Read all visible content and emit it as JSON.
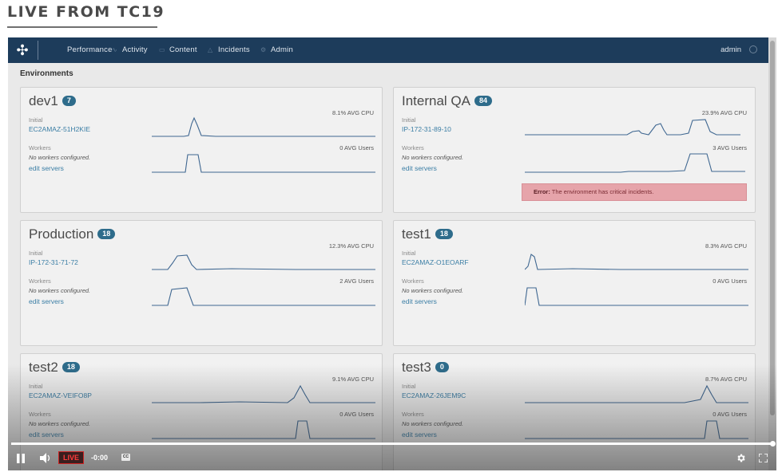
{
  "page": {
    "heading": "LIVE FROM TC19"
  },
  "nav": {
    "items": [
      {
        "label": "Performance",
        "icon": "performance-icon"
      },
      {
        "label": "Activity",
        "icon": "activity-icon"
      },
      {
        "label": "Content",
        "icon": "content-icon"
      },
      {
        "label": "Incidents",
        "icon": "incidents-icon"
      },
      {
        "label": "Admin",
        "icon": "admin-icon"
      }
    ],
    "user": "admin"
  },
  "section_title": "Environments",
  "environments": [
    {
      "name": "dev1",
      "count": "7",
      "initial_label": "Initial",
      "host": "EC2AMAZ-51H2KIE",
      "cpu": "8.1% AVG CPU",
      "workers_label": "Workers",
      "workers_note": "No workers configured.",
      "edit_link": "edit servers",
      "users": "0 AVG Users"
    },
    {
      "name": "Internal QA",
      "count": "84",
      "initial_label": "Initial",
      "host": "IP-172-31-89-10",
      "cpu": "23.9% AVG CPU",
      "workers_label": "Workers",
      "workers_note": "No workers configured.",
      "edit_link": "edit servers",
      "users": "3 AVG Users",
      "error_label": "Error:",
      "error_text": "The environment has critical incidents."
    },
    {
      "name": "Production",
      "count": "18",
      "initial_label": "Initial",
      "host": "IP-172-31-71-72",
      "cpu": "12.3% AVG CPU",
      "workers_label": "Workers",
      "workers_note": "No workers configured.",
      "edit_link": "edit servers",
      "users": "2 AVG Users"
    },
    {
      "name": "test1",
      "count": "18",
      "initial_label": "Initial",
      "host": "EC2AMAZ-O1EOARF",
      "cpu": "8.3% AVG CPU",
      "workers_label": "Workers",
      "workers_note": "No workers configured.",
      "edit_link": "edit servers",
      "users": "0 AVG Users"
    },
    {
      "name": "test2",
      "count": "18",
      "initial_label": "Initial",
      "host": "EC2AMAZ-VEIFO8P",
      "cpu": "9.1% AVG CPU",
      "workers_label": "Workers",
      "workers_note": "No workers configured.",
      "edit_link": "edit servers",
      "users": "0 AVG Users"
    },
    {
      "name": "test3",
      "count": "0",
      "initial_label": "Initial",
      "host": "EC2AMAZ-26JEM9C",
      "cpu": "8.7% AVG CPU",
      "workers_label": "Workers",
      "workers_note": "No workers configured.",
      "edit_link": "edit servers",
      "users": "0 AVG Users"
    }
  ],
  "player": {
    "live_label": "LIVE",
    "time": "-0:00",
    "cc_label": "CC"
  },
  "colors": {
    "nav_bg": "#1d3c5b",
    "badge": "#2e6c8b",
    "link": "#3b7ea5",
    "sparkline": "#3f6791",
    "error_bg": "#e6a4aa",
    "live_red": "#ff3b3b"
  }
}
